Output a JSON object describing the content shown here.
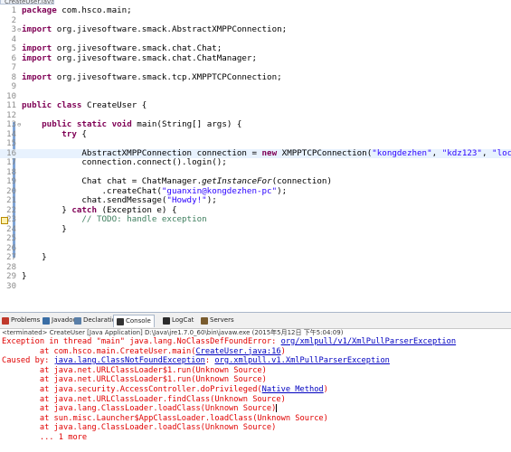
{
  "editor": {
    "file_tab": "CreateUser.java",
    "lines": [
      {
        "n": "1",
        "fold": "",
        "hl": false,
        "parts": [
          {
            "t": "package ",
            "c": "kw"
          },
          {
            "t": "com.hsco.main;"
          }
        ]
      },
      {
        "n": "2",
        "fold": "",
        "hl": false,
        "parts": []
      },
      {
        "n": "3",
        "fold": "⊖",
        "hl": false,
        "parts": [
          {
            "t": "import ",
            "c": "kw"
          },
          {
            "t": "org.jivesoftware.smack.AbstractXMPPConnection;"
          }
        ]
      },
      {
        "n": "4",
        "fold": "",
        "hl": false,
        "parts": []
      },
      {
        "n": "5",
        "fold": "",
        "hl": false,
        "parts": [
          {
            "t": "import ",
            "c": "kw"
          },
          {
            "t": "org.jivesoftware.smack.chat.Chat;"
          }
        ]
      },
      {
        "n": "6",
        "fold": "",
        "hl": false,
        "parts": [
          {
            "t": "import ",
            "c": "kw"
          },
          {
            "t": "org.jivesoftware.smack.chat.ChatManager;"
          }
        ]
      },
      {
        "n": "7",
        "fold": "",
        "hl": false,
        "parts": []
      },
      {
        "n": "8",
        "fold": "",
        "hl": false,
        "parts": [
          {
            "t": "import ",
            "c": "kw"
          },
          {
            "t": "org.jivesoftware.smack.tcp.XMPPTCPConnection;"
          }
        ]
      },
      {
        "n": "9",
        "fold": "",
        "hl": false,
        "parts": []
      },
      {
        "n": "10",
        "fold": "",
        "hl": false,
        "parts": []
      },
      {
        "n": "11",
        "fold": "",
        "hl": false,
        "parts": [
          {
            "t": "public ",
            "c": "kw"
          },
          {
            "t": "class ",
            "c": "kw"
          },
          {
            "t": "CreateUser {"
          }
        ]
      },
      {
        "n": "12",
        "fold": "",
        "hl": false,
        "parts": []
      },
      {
        "n": "13",
        "fold": "⊖",
        "hl": false,
        "parts": [
          {
            "t": "    "
          },
          {
            "t": "public ",
            "c": "kw"
          },
          {
            "t": "static ",
            "c": "kw"
          },
          {
            "t": "void ",
            "c": "kw"
          },
          {
            "t": "main(String[] args) {"
          }
        ]
      },
      {
        "n": "14",
        "fold": "",
        "hl": false,
        "parts": [
          {
            "t": "        "
          },
          {
            "t": "try ",
            "c": "kw"
          },
          {
            "t": "{"
          }
        ]
      },
      {
        "n": "15",
        "fold": "",
        "hl": false,
        "parts": []
      },
      {
        "n": "16",
        "fold": "",
        "hl": true,
        "parts": [
          {
            "t": "            AbstractXMPPConnection connection = "
          },
          {
            "t": "new ",
            "c": "kw"
          },
          {
            "t": "XMPPTCPConnection("
          },
          {
            "t": "\"kongdezhen\"",
            "c": "str"
          },
          {
            "t": ", "
          },
          {
            "t": "\"kdz123\"",
            "c": "str"
          },
          {
            "t": ", "
          },
          {
            "t": "\"localhost\"",
            "c": "str"
          },
          {
            "t": ");"
          }
        ]
      },
      {
        "n": "17",
        "fold": "",
        "hl": false,
        "parts": [
          {
            "t": "            connection.connect().login();"
          }
        ]
      },
      {
        "n": "18",
        "fold": "",
        "hl": false,
        "parts": []
      },
      {
        "n": "19",
        "fold": "",
        "hl": false,
        "parts": [
          {
            "t": "            Chat chat = ChatManager."
          },
          {
            "t": "getInstanceFor",
            "c": "it"
          },
          {
            "t": "(connection)"
          }
        ]
      },
      {
        "n": "20",
        "fold": "",
        "hl": false,
        "parts": [
          {
            "t": "                .createChat("
          },
          {
            "t": "\"guanxin@kongdezhen-pc\"",
            "c": "str"
          },
          {
            "t": ");"
          }
        ]
      },
      {
        "n": "21",
        "fold": "",
        "hl": false,
        "parts": [
          {
            "t": "            chat.sendMessage("
          },
          {
            "t": "\"Howdy!\"",
            "c": "str"
          },
          {
            "t": ");"
          }
        ]
      },
      {
        "n": "22",
        "fold": "",
        "hl": false,
        "parts": [
          {
            "t": "        } "
          },
          {
            "t": "catch ",
            "c": "kw"
          },
          {
            "t": "(Exception e) {"
          }
        ]
      },
      {
        "n": "23",
        "fold": "",
        "hl": false,
        "parts": [
          {
            "t": "            "
          },
          {
            "t": "// TODO: handle exception",
            "c": "cm"
          }
        ]
      },
      {
        "n": "24",
        "fold": "",
        "hl": false,
        "parts": [
          {
            "t": "        }"
          }
        ]
      },
      {
        "n": "25",
        "fold": "",
        "hl": false,
        "parts": []
      },
      {
        "n": "26",
        "fold": "",
        "hl": false,
        "parts": []
      },
      {
        "n": "27",
        "fold": "",
        "hl": false,
        "parts": [
          {
            "t": "    }"
          }
        ]
      },
      {
        "n": "28",
        "fold": "",
        "hl": false,
        "parts": []
      },
      {
        "n": "29",
        "fold": "",
        "hl": false,
        "parts": [
          {
            "t": "}"
          }
        ]
      },
      {
        "n": "30",
        "fold": "",
        "hl": false,
        "parts": []
      }
    ]
  },
  "views": {
    "tabs": [
      {
        "label": "Problems",
        "icon": "problems-icon",
        "color": "#c0392b",
        "active": false
      },
      {
        "label": "Javadoc",
        "icon": "javadoc-icon",
        "color": "#3a6ea5",
        "active": false
      },
      {
        "label": "Declaration",
        "icon": "declaration-icon",
        "color": "#5a7fa8",
        "active": false
      },
      {
        "label": "Console",
        "icon": "console-icon",
        "color": "#333333",
        "active": true
      },
      {
        "label": "LogCat",
        "icon": "logcat-icon",
        "color": "#2b2b2b",
        "active": false
      },
      {
        "label": "Servers",
        "icon": "servers-icon",
        "color": "#7a5c2e",
        "active": false
      }
    ]
  },
  "console": {
    "info": "<terminated> CreateUser [Java Application] D:\\Java\\jre1.7.0_60\\bin\\javaw.exe (2015年5月12日 下午5:04:09)",
    "lines": [
      {
        "parts": [
          {
            "t": "Exception in thread \"main\" java.lang.NoClassDefFoundError: "
          },
          {
            "t": "org/xmlpull/v1/XmlPullParserException",
            "c": "link"
          }
        ]
      },
      {
        "parts": [
          {
            "t": "\tat com.hsco.main.CreateUser.main("
          },
          {
            "t": "CreateUser.java:16",
            "c": "link"
          },
          {
            "t": ")"
          }
        ]
      },
      {
        "parts": [
          {
            "t": "Caused by: "
          },
          {
            "t": "java.lang.ClassNotFoundException",
            "c": "link"
          },
          {
            "t": ": "
          },
          {
            "t": "org.xmlpull.v1.XmlPullParserException",
            "c": "link"
          }
        ]
      },
      {
        "parts": [
          {
            "t": "\tat java.net.URLClassLoader$1.run(Unknown Source)"
          }
        ]
      },
      {
        "parts": [
          {
            "t": "\tat java.net.URLClassLoader$1.run(Unknown Source)"
          }
        ]
      },
      {
        "parts": [
          {
            "t": "\tat java.security.AccessController.doPrivileged("
          },
          {
            "t": "Native Method",
            "c": "link"
          },
          {
            "t": ")"
          }
        ]
      },
      {
        "parts": [
          {
            "t": "\tat java.net.URLClassLoader.findClass(Unknown Source)"
          }
        ]
      },
      {
        "parts": [
          {
            "t": "\tat java.lang.ClassLoader.loadClass(Unknown Source)"
          },
          {
            "t": "",
            "c": "cursor"
          }
        ]
      },
      {
        "parts": [
          {
            "t": "\tat sun.misc.Launcher$AppClassLoader.loadClass(Unknown Source)"
          }
        ]
      },
      {
        "parts": [
          {
            "t": "\tat java.lang.ClassLoader.loadClass(Unknown Source)"
          }
        ]
      },
      {
        "parts": [
          {
            "t": "\t... 1 more"
          }
        ]
      }
    ]
  }
}
